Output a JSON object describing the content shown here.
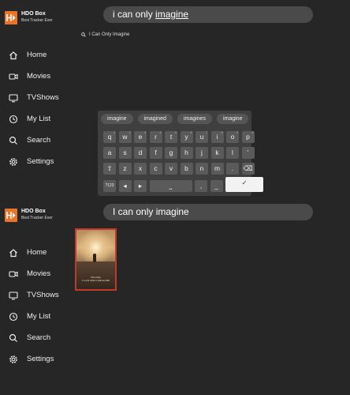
{
  "app": {
    "title": "HDO Box",
    "subtitle": "Best Tracker Ever",
    "accent": "#e8742a"
  },
  "top": {
    "search_prefix": "i can only ",
    "search_underlined": "imagine",
    "suggestion": "I Can Only Imagine"
  },
  "nav": [
    {
      "label": "Home",
      "icon": "home-icon"
    },
    {
      "label": "Movies",
      "icon": "video-camera-icon"
    },
    {
      "label": "TVShows",
      "icon": "tv-icon"
    },
    {
      "label": "My List",
      "icon": "clock-icon"
    },
    {
      "label": "Search",
      "icon": "search-icon"
    },
    {
      "label": "Settings",
      "icon": "gear-icon"
    }
  ],
  "keyboard": {
    "suggestions": [
      "imagine",
      "imagined",
      "imagines",
      "imagine"
    ],
    "row1": [
      [
        "q",
        "1"
      ],
      [
        "w",
        "2"
      ],
      [
        "e",
        "3"
      ],
      [
        "r",
        "4"
      ],
      [
        "t",
        "5"
      ],
      [
        "y",
        "6"
      ],
      [
        "u",
        "7"
      ],
      [
        "i",
        "8"
      ],
      [
        "o",
        "9"
      ],
      [
        "p",
        "0"
      ]
    ],
    "row2": [
      "a",
      "s",
      "d",
      "f",
      "g",
      "h",
      "j",
      "k",
      "l",
      "'"
    ],
    "row3": [
      "⇧",
      "z",
      "x",
      "c",
      "v",
      "b",
      "n",
      "m",
      ".",
      "⌫"
    ],
    "row4": {
      "symbols": "?123",
      "left": "◂",
      "right": "▸",
      "space": "⎵",
      "comma": ",",
      "dash": "_",
      "ok": "✓"
    }
  },
  "bottom": {
    "search_text": "I can only imagine",
    "poster_title": "I CAN ONLY IMAGINE",
    "poster_tagline": "The Only"
  }
}
